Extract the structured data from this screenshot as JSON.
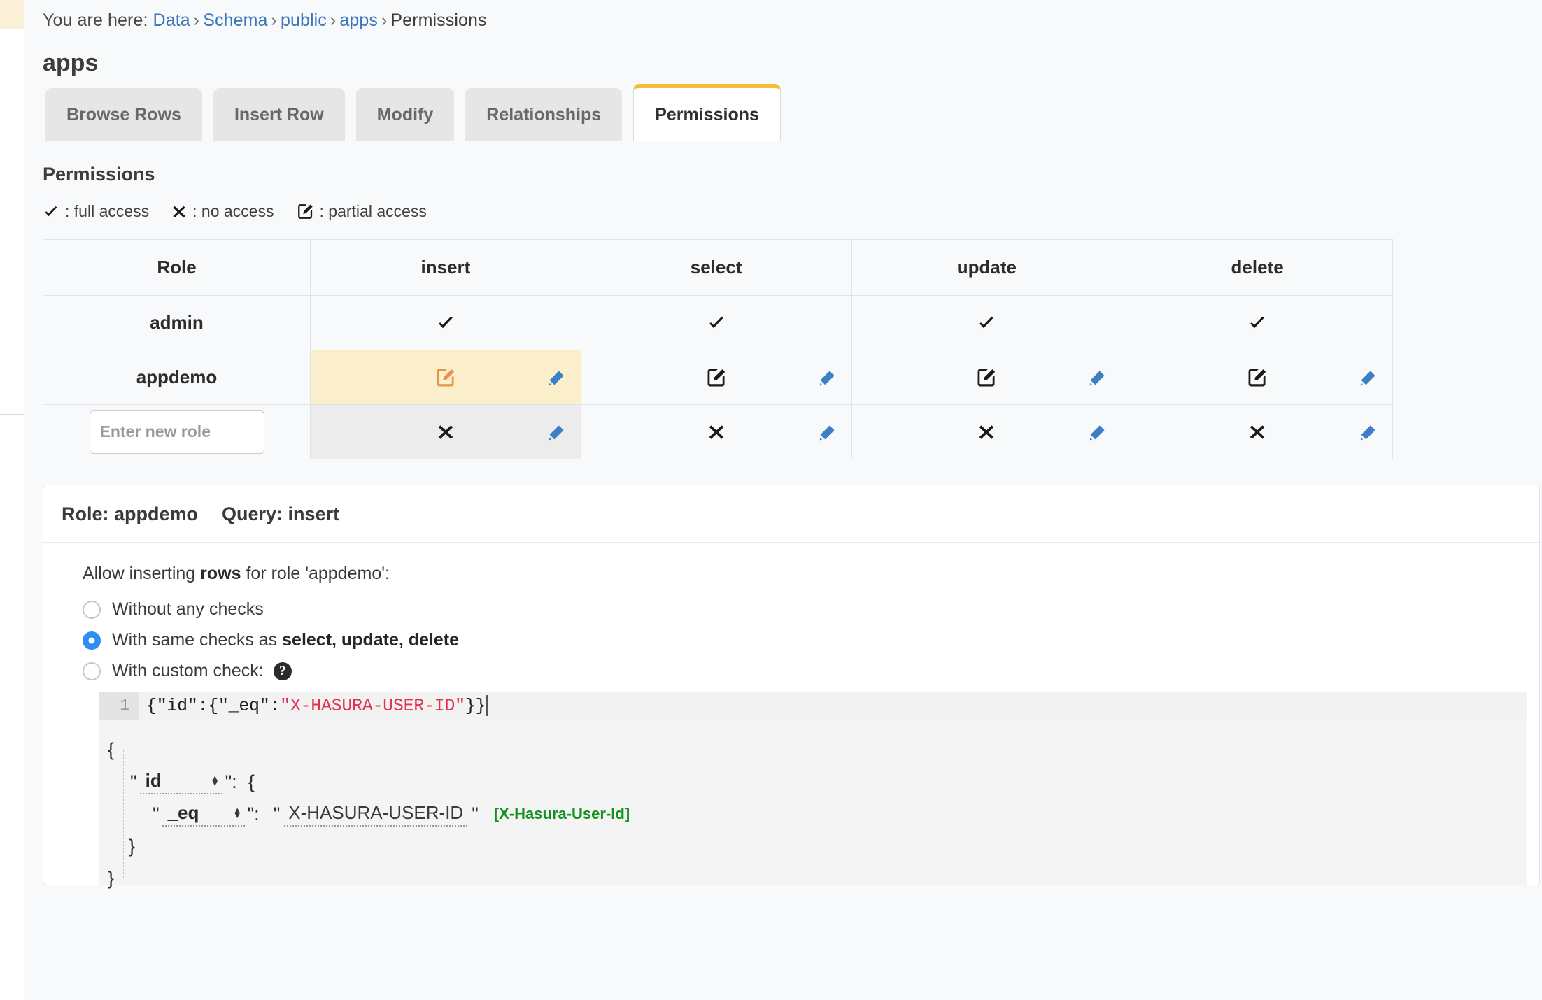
{
  "breadcrumb": {
    "prefix": "You are here:",
    "items": [
      {
        "label": "Data",
        "link": true
      },
      {
        "label": "Schema",
        "link": true
      },
      {
        "label": "public",
        "link": true
      },
      {
        "label": "apps",
        "link": true
      },
      {
        "label": "Permissions",
        "link": false
      }
    ],
    "separator": "›"
  },
  "page_title": "apps",
  "tabs": [
    {
      "label": "Browse Rows",
      "active": false
    },
    {
      "label": "Insert Row",
      "active": false
    },
    {
      "label": "Modify",
      "active": false
    },
    {
      "label": "Relationships",
      "active": false
    },
    {
      "label": "Permissions",
      "active": true
    }
  ],
  "permissions": {
    "section_title": "Permissions",
    "legend": [
      {
        "icon": "check-icon",
        "glyph": "✔",
        "label": ": full access"
      },
      {
        "icon": "cross-icon",
        "glyph": "✖",
        "label": ": no access"
      },
      {
        "icon": "edit-square-icon",
        "glyph": "✎",
        "label": ": partial access"
      }
    ],
    "columns": [
      "Role",
      "insert",
      "select",
      "update",
      "delete"
    ],
    "rows": [
      {
        "role": "admin",
        "role_is_input": false,
        "cells": [
          {
            "state": "full",
            "glyph": "✔",
            "highlight": "none",
            "has_pencil": false
          },
          {
            "state": "full",
            "glyph": "✔",
            "highlight": "none",
            "has_pencil": false
          },
          {
            "state": "full",
            "glyph": "✔",
            "highlight": "none",
            "has_pencil": false
          },
          {
            "state": "full",
            "glyph": "✔",
            "highlight": "none",
            "has_pencil": false
          }
        ]
      },
      {
        "role": "appdemo",
        "role_is_input": false,
        "cells": [
          {
            "state": "partial",
            "glyph": "✎",
            "highlight": "orange",
            "has_pencil": true
          },
          {
            "state": "partial",
            "glyph": "✎",
            "highlight": "none",
            "has_pencil": true
          },
          {
            "state": "partial",
            "glyph": "✎",
            "highlight": "none",
            "has_pencil": true
          },
          {
            "state": "partial",
            "glyph": "✎",
            "highlight": "none",
            "has_pencil": true
          }
        ]
      },
      {
        "role": "",
        "role_is_input": true,
        "role_placeholder": "Enter new role",
        "cells": [
          {
            "state": "none",
            "glyph": "✖",
            "highlight": "grey",
            "has_pencil": true
          },
          {
            "state": "none",
            "glyph": "✖",
            "highlight": "none",
            "has_pencil": true
          },
          {
            "state": "none",
            "glyph": "✖",
            "highlight": "none",
            "has_pencil": true
          },
          {
            "state": "none",
            "glyph": "✖",
            "highlight": "none",
            "has_pencil": true
          }
        ]
      }
    ]
  },
  "editor": {
    "header_role": "Role: appdemo",
    "header_query": "Query: insert",
    "allow_text_a": "Allow inserting ",
    "allow_text_bold": "rows",
    "allow_text_b": " for role 'appdemo':",
    "options": [
      {
        "label_a": "Without any checks",
        "label_bold": "",
        "label_b": "",
        "selected": false,
        "help": false
      },
      {
        "label_a": "With same checks as ",
        "label_bold": "select, update, delete",
        "label_b": "",
        "selected": true,
        "help": false
      },
      {
        "label_a": "With custom check: ",
        "label_bold": "",
        "label_b": "",
        "selected": false,
        "help": true,
        "help_glyph": "?"
      }
    ],
    "code": {
      "line_number": "1",
      "prefix": "{\"id\":{\"_eq\":",
      "string": "\"X-HASURA-USER-ID\"",
      "suffix": "}}"
    },
    "json_builder": {
      "open_brace": "{",
      "key1": "id",
      "key1_colon": "\":",
      "key1_open": "{",
      "key2": "_eq",
      "key2_colon": "\":",
      "value": "X-HASURA-USER-ID",
      "hint": "[X-Hasura-User-Id]",
      "close_inner": "}",
      "close_outer": "}",
      "quote": "\"",
      "spinner_up": "▲",
      "spinner_down": "▼"
    }
  },
  "colors": {
    "accent_tab": "#f8bb39",
    "link": "#3b75b9",
    "highlight_orange_bg": "#fbeecb",
    "icon_orange": "#e8924a",
    "pencil_blue": "#3b7fc4",
    "radio_selected": "#2f8ef4",
    "code_string": "#e03151",
    "hint_green": "#13921f"
  }
}
